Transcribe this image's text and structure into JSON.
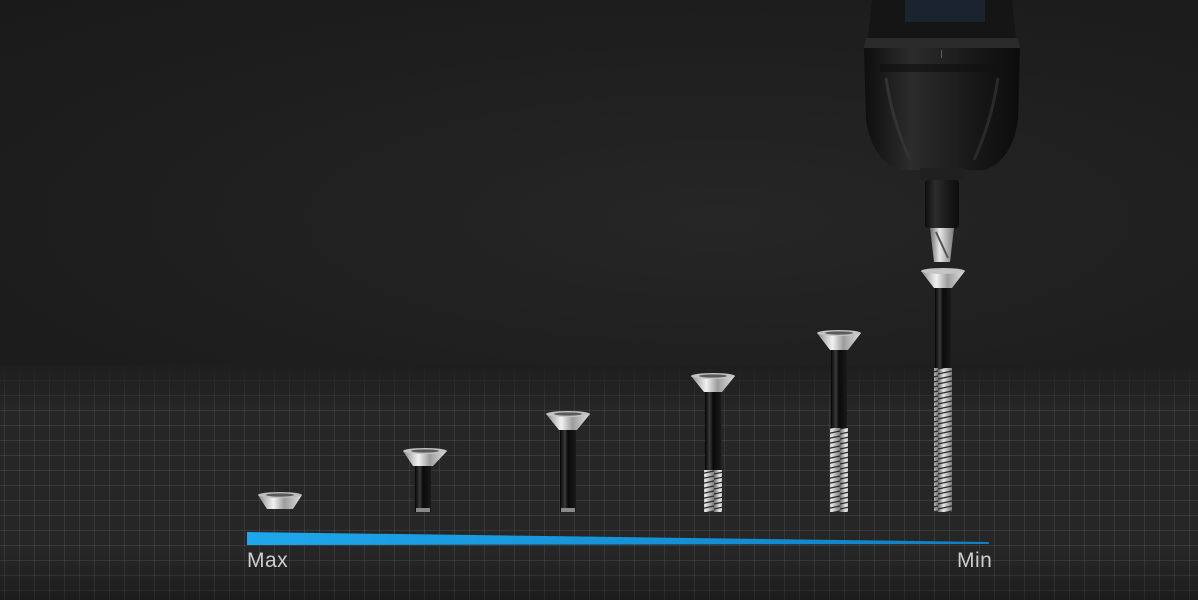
{
  "scale": {
    "max_label": "Max",
    "min_label": "Min"
  },
  "colors": {
    "background": "#1f1f1f",
    "accent_bar": "#1aa3e8",
    "screw_metal": "#c9c9c9",
    "screw_shaft": "#0d0d0d",
    "drill_body": "#1b1b1b"
  },
  "screws": [
    {
      "id": "screw-1",
      "depth_level": 0
    },
    {
      "id": "screw-2",
      "depth_level": 1
    },
    {
      "id": "screw-3",
      "depth_level": 2
    },
    {
      "id": "screw-4",
      "depth_level": 3
    },
    {
      "id": "screw-5",
      "depth_level": 4
    },
    {
      "id": "screw-6",
      "depth_level": 5
    }
  ]
}
